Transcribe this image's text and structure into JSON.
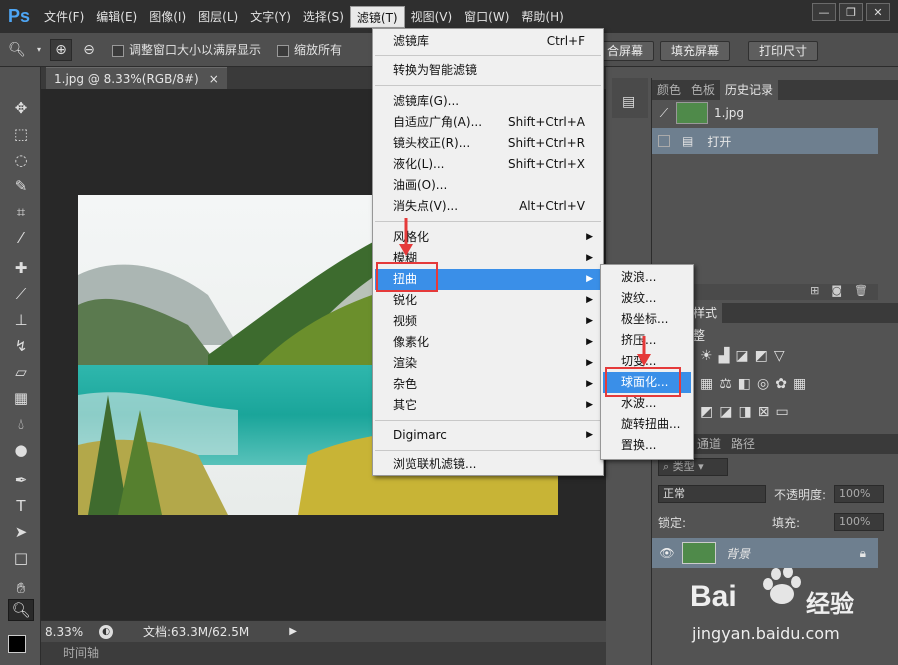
{
  "app": {
    "logo": "Ps",
    "menubar": [
      "文件(F)",
      "编辑(E)",
      "图像(I)",
      "图层(L)",
      "文字(Y)",
      "选择(S)",
      "滤镜(T)",
      "视图(V)",
      "窗口(W)",
      "帮助(H)"
    ],
    "window_controls": [
      "—",
      "❐",
      "✕"
    ]
  },
  "options": {
    "checkbox1": "调整窗口大小以满屏显示",
    "checkbox2": "缩放所有",
    "btn_fit": "合屏幕",
    "btn_fill": "填充屏幕",
    "btn_print": "打印尺寸"
  },
  "document": {
    "tab_title": "1.jpg @ 8.33%(RGB/8#)",
    "tab_close": "×",
    "zoom": "8.33%",
    "doc_size": "文档:63.3M/62.5M",
    "timeline": "时间轴"
  },
  "filter_menu": {
    "items": [
      {
        "label": "滤镜库",
        "shortcut": "Ctrl+F"
      },
      {
        "label": "转换为智能滤镜",
        "shortcut": ""
      },
      {
        "label": "滤镜库(G)...",
        "shortcut": ""
      },
      {
        "label": "自适应广角(A)...",
        "shortcut": "Shift+Ctrl+A"
      },
      {
        "label": "镜头校正(R)...",
        "shortcut": "Shift+Ctrl+R"
      },
      {
        "label": "液化(L)...",
        "shortcut": "Shift+Ctrl+X"
      },
      {
        "label": "油画(O)...",
        "shortcut": ""
      },
      {
        "label": "消失点(V)...",
        "shortcut": "Alt+Ctrl+V"
      },
      {
        "label": "风格化",
        "shortcut": ""
      },
      {
        "label": "模糊",
        "shortcut": ""
      },
      {
        "label": "扭曲",
        "shortcut": ""
      },
      {
        "label": "锐化",
        "shortcut": ""
      },
      {
        "label": "视频",
        "shortcut": ""
      },
      {
        "label": "像素化",
        "shortcut": ""
      },
      {
        "label": "渲染",
        "shortcut": ""
      },
      {
        "label": "杂色",
        "shortcut": ""
      },
      {
        "label": "其它",
        "shortcut": ""
      },
      {
        "label": "Digimarc",
        "shortcut": ""
      },
      {
        "label": "浏览联机滤镜...",
        "shortcut": ""
      }
    ]
  },
  "distort_submenu": {
    "items": [
      "波浪...",
      "波纹...",
      "极坐标...",
      "挤压...",
      "切变...",
      "球面化...",
      "水波...",
      "旋转扭曲...",
      "置换..."
    ]
  },
  "panels": {
    "tabs_top": [
      "颜色",
      "色板",
      "历史记录"
    ],
    "history_snapshot": "1.jpg",
    "history_step": "打开",
    "tabs_mid": [
      "样式"
    ],
    "adjust_title": "整",
    "tabs_layers": [
      "通道",
      "路径"
    ],
    "filter_kind": "类型",
    "blend_mode": "正常",
    "opacity_label": "不透明度:",
    "opacity_value": "100%",
    "lock_label": "锁定:",
    "fill_label": "填充:",
    "fill_value": "100%",
    "layer_name": "背景"
  },
  "watermark": {
    "brand": "Bai",
    "brand2": "经验",
    "url": "jingyan.baidu.com"
  },
  "colors": {
    "highlight": "#3a8fe8",
    "annotation_red": "#e53a3a",
    "ps_blue": "#4ea6f5"
  }
}
